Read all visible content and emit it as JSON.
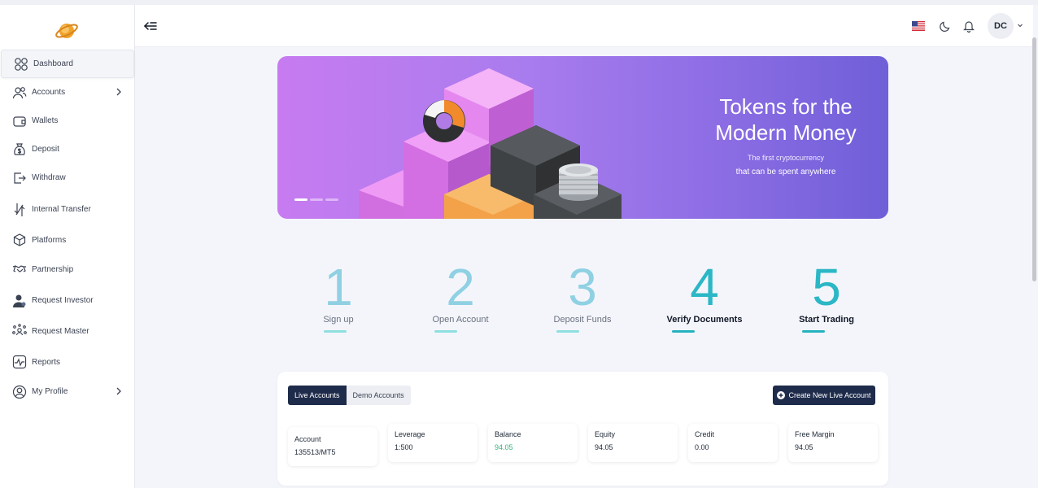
{
  "sidebar": {
    "items": [
      {
        "label": "Dashboard",
        "icon": "dashboard-icon"
      },
      {
        "label": "Accounts",
        "icon": "users-icon"
      },
      {
        "label": "Wallets",
        "icon": "wallet-icon"
      },
      {
        "label": "Deposit",
        "icon": "money-bag-icon"
      },
      {
        "label": "Withdraw",
        "icon": "withdraw-icon"
      },
      {
        "label": "Internal Transfer",
        "icon": "transfer-icon"
      },
      {
        "label": "Platforms",
        "icon": "cube-icon"
      },
      {
        "label": "Partnership",
        "icon": "handshake-icon"
      },
      {
        "label": "Request Investor",
        "icon": "investor-icon"
      },
      {
        "label": "Request Master",
        "icon": "network-icon"
      },
      {
        "label": "Reports",
        "icon": "chart-pulse-icon"
      },
      {
        "label": "My Profile",
        "icon": "profile-icon"
      }
    ]
  },
  "header": {
    "avatar_initials": "DC"
  },
  "banner": {
    "title": "Tokens for the Modern Money",
    "subtitle_1": "The first cryptocurrency",
    "subtitle_2": "that can be spent anywhere"
  },
  "steps": [
    {
      "number": "1",
      "label": "Sign up",
      "status": "done"
    },
    {
      "number": "2",
      "label": "Open Account",
      "status": "done"
    },
    {
      "number": "3",
      "label": "Deposit Funds",
      "status": "done"
    },
    {
      "number": "4",
      "label": "Verify Documents",
      "status": "pending"
    },
    {
      "number": "5",
      "label": "Start Trading",
      "status": "pending"
    }
  ],
  "accounts": {
    "tabs": [
      "Live Accounts",
      "Demo Accounts"
    ],
    "create_label": "Create New Live Account",
    "stats": [
      {
        "label": "Account",
        "value": "135513/MT5"
      },
      {
        "label": "Leverage",
        "value": "1:500"
      },
      {
        "label": "Balance",
        "value": "94.05"
      },
      {
        "label": "Equity",
        "value": "94.05"
      },
      {
        "label": "Credit",
        "value": "0.00"
      },
      {
        "label": "Free Margin",
        "value": "94.05"
      }
    ]
  },
  "colors": {
    "navy": "#1e2b4a",
    "teal": "#2bb7c5",
    "green": "#36b37e",
    "banner_start": "#c77bf0",
    "banner_end": "#6f5fd8"
  }
}
